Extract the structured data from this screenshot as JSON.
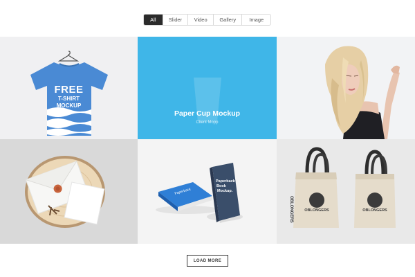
{
  "filters": {
    "tabs": [
      {
        "label": "All",
        "active": true
      },
      {
        "label": "Slider",
        "active": false
      },
      {
        "label": "Video",
        "active": false
      },
      {
        "label": "Gallery",
        "active": false
      },
      {
        "label": "Image",
        "active": false
      }
    ]
  },
  "grid": {
    "items": [
      {
        "image": "t-shirt-mockup",
        "print": [
          "FREE",
          "T-SHIRT",
          "MOCKUP"
        ]
      },
      {
        "image": "paper-cup-mockup",
        "title": "Paper Cup Mockup",
        "subtitle": "Client Mopp"
      },
      {
        "image": "woman-portrait"
      },
      {
        "image": "envelope-on-wood-slice"
      },
      {
        "image": "paperback-book-mockup",
        "cover": "Paperback Book Mockup"
      },
      {
        "image": "tote-bags-mockup",
        "brand": "OBLONGERS"
      }
    ]
  },
  "load_more": {
    "label": "LOAD MORE"
  },
  "colors": {
    "accent": "#3fb6e8",
    "tshirt": "#4a8ad4",
    "active_tab": "#2b2b2b"
  }
}
